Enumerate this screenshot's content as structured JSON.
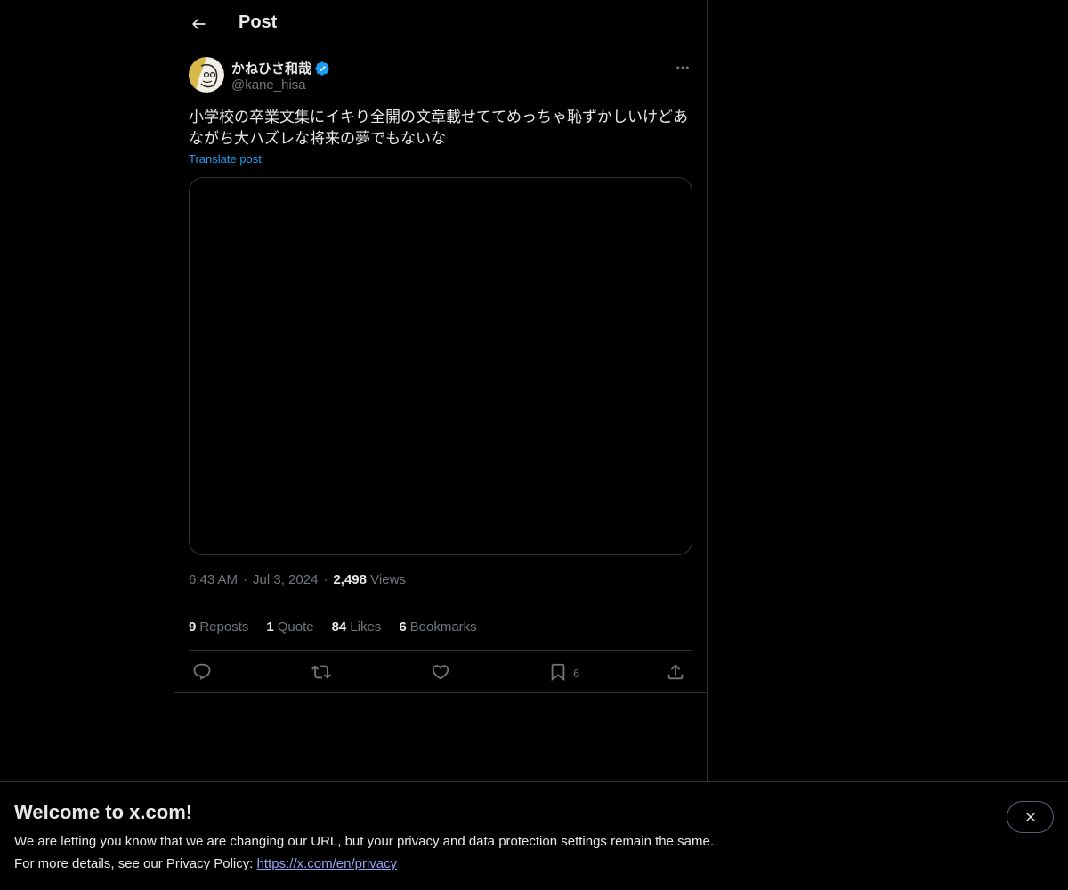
{
  "header": {
    "title": "Post",
    "back_icon": "arrow-left-icon"
  },
  "author": {
    "name": "かねひさ和哉",
    "handle": "@kane_hisa",
    "verified": true,
    "verified_color": "#1d9bf0"
  },
  "post": {
    "text_line1": "小学校の卒業文集にイキり全開の文章載せててめっちゃ恥ずかしいけどあ",
    "text_line2": "ながち大ハズレな将来の夢でもないな",
    "translate_label": "Translate post"
  },
  "meta": {
    "time": "6:43 AM",
    "date": "Jul 3, 2024",
    "views_count": "2,498",
    "views_label": "Views"
  },
  "stats": {
    "reposts_count": "9",
    "reposts_label": "Reposts",
    "quotes_count": "1",
    "quotes_label": "Quote",
    "likes_count": "84",
    "likes_label": "Likes",
    "bookmarks_count": "6",
    "bookmarks_label": "Bookmarks"
  },
  "actions": {
    "reply_icon": "reply-icon",
    "repost_icon": "repost-icon",
    "like_icon": "heart-icon",
    "bookmark_icon": "bookmark-icon",
    "bookmark_count": "6",
    "share_icon": "share-icon"
  },
  "banner": {
    "title": "Welcome to x.com!",
    "line1": "We are letting you know that we are changing our URL, but your privacy and data protection settings remain the same.",
    "line2_prefix": "For more details, see our Privacy Policy: ",
    "link_text": "https://x.com/en/privacy"
  },
  "colors": {
    "background": "#000000",
    "text": "#e7e9ea",
    "muted": "#71767b",
    "accent": "#1d9bf0",
    "link": "#9b9ff5"
  }
}
